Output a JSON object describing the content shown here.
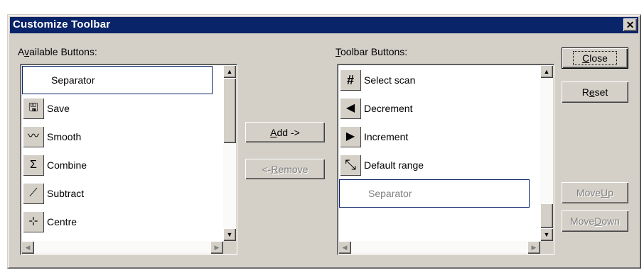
{
  "dialog": {
    "title": "Customize Toolbar",
    "close_glyph": "✕"
  },
  "available": {
    "label_pre": "A",
    "label_u": "v",
    "label_post": "ailable Buttons:",
    "items": [
      {
        "label": "Separator",
        "icon": "",
        "icon_name": "none"
      },
      {
        "label": "Save",
        "icon": "🖫",
        "icon_name": "save-icon"
      },
      {
        "label": "Smooth",
        "icon": "〰",
        "icon_name": "smooth-icon"
      },
      {
        "label": "Combine",
        "icon": "Σ",
        "icon_name": "combine-icon"
      },
      {
        "label": "Subtract",
        "icon": "⟋",
        "icon_name": "subtract-icon"
      },
      {
        "label": "Centre",
        "icon": "⊹",
        "icon_name": "centre-icon"
      }
    ]
  },
  "toolbar": {
    "label_u": "T",
    "label_post": "oolbar Buttons:",
    "items": [
      {
        "label": "Select scan",
        "icon": "#",
        "icon_name": "hash-icon"
      },
      {
        "label": "Decrement",
        "icon": "◀",
        "icon_name": "left-arrow-icon"
      },
      {
        "label": "Increment",
        "icon": "▶",
        "icon_name": "right-arrow-icon"
      },
      {
        "label": "Default range",
        "icon": "⤡",
        "icon_name": "expand-icon"
      },
      {
        "label": "Separator",
        "icon": "",
        "icon_name": "none"
      }
    ]
  },
  "buttons": {
    "add_u": "A",
    "add_post": "dd ->",
    "remove_pre": "<- ",
    "remove_u": "R",
    "remove_post": "emove",
    "close_u": "C",
    "close_post": "lose",
    "reset_pre": "R",
    "reset_u": "e",
    "reset_post": "set",
    "moveup_pre": "Move ",
    "moveup_u": "U",
    "moveup_post": "p",
    "movedown_pre": "Move ",
    "movedown_u": "D",
    "movedown_post": "own"
  },
  "scroll": {
    "up": "▲",
    "down": "▼",
    "left": "◀",
    "right": "▶"
  },
  "colors": {
    "titlebar": "#0a246a",
    "face": "#d4d0c8"
  }
}
